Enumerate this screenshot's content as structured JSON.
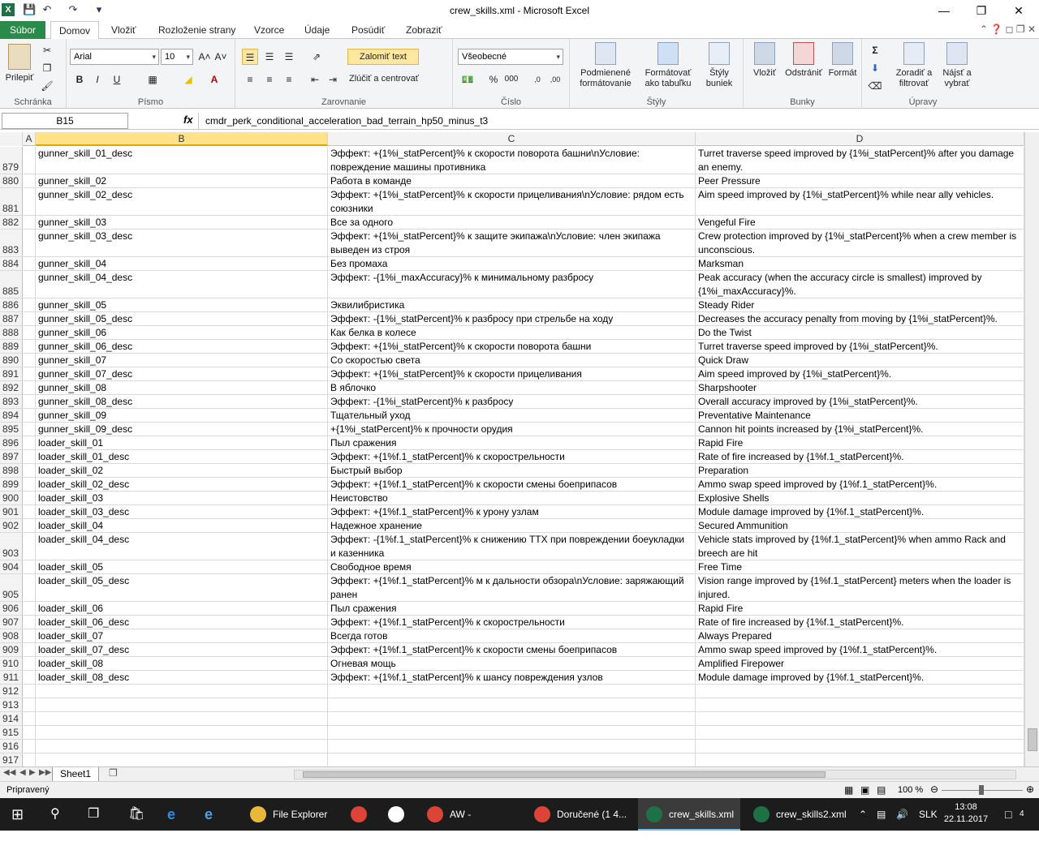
{
  "window": {
    "title": "crew_skills.xml  -  Microsoft Excel",
    "app_icon": "X",
    "qat": [
      "save-icon",
      "undo-icon",
      "redo-icon",
      "customize-icon"
    ],
    "controls": [
      "minimize-icon",
      "restore-icon",
      "close-icon"
    ]
  },
  "ribbon_tabs": {
    "file": "Súbor",
    "items": [
      "Domov",
      "Vložiť",
      "Rozloženie strany",
      "Vzorce",
      "Údaje",
      "Posúdiť",
      "Zobraziť"
    ],
    "active": "Domov"
  },
  "ribbon": {
    "clipboard": {
      "label": "Schránka",
      "paste": "Prilepiť"
    },
    "font": {
      "label": "Písmo",
      "name": "Arial",
      "size": "10",
      "bold": "B",
      "italic": "I",
      "underline": "U"
    },
    "alignment": {
      "label": "Zarovnanie",
      "wrap": "Zalomiť text",
      "merge": "Zlúčiť a centrovať"
    },
    "number": {
      "label": "Číslo",
      "format": "Všeobecné"
    },
    "styles": {
      "label": "Štýly",
      "conditional": [
        "Podmienené",
        "formátovanie"
      ],
      "table": [
        "Formátovať",
        "ako tabuľku"
      ],
      "cell": [
        "Štýly",
        "buniek"
      ]
    },
    "cells": {
      "label": "Bunky",
      "insert": "Vložiť",
      "delete": "Odstrániť",
      "format": "Formát"
    },
    "editing": {
      "label": "Úpravy",
      "sort": [
        "Zoradiť a",
        "filtrovať"
      ],
      "find": [
        "Nájsť a",
        "vybrať"
      ]
    }
  },
  "formula_bar": {
    "name_box": "B15",
    "fx": "fx",
    "formula": "cmdr_perk_conditional_acceleration_bad_terrain_hp50_minus_t3"
  },
  "columns": [
    "A",
    "B",
    "C",
    "D"
  ],
  "selected_column": "B",
  "rows": [
    {
      "n": "879",
      "b": "gunner_skill_01_desc",
      "c": "Эффект: +{1%i_statPercent}% к скорости поворота башни\\nУсловие: повреждение машины противника",
      "d": "Turret traverse speed improved by {1%i_statPercent}% after you damage an enemy.",
      "tall": true
    },
    {
      "n": "880",
      "b": "gunner_skill_02",
      "c": "Работа в команде",
      "d": "Peer Pressure"
    },
    {
      "n": "881",
      "b": "gunner_skill_02_desc",
      "c": "Эффект: +{1%i_statPercent}% к скорости прицеливания\\nУсловие: рядом есть союзники",
      "d": "Aim speed improved by {1%i_statPercent}% while near ally vehicles.",
      "tall": true
    },
    {
      "n": "882",
      "b": "gunner_skill_03",
      "c": "Все за одного",
      "d": "Vengeful Fire"
    },
    {
      "n": "883",
      "b": "gunner_skill_03_desc",
      "c": "Эффект: +{1%i_statPercent}% к защите экипажа\\nУсловие: член экипажа выведен из строя",
      "d": "Crew protection improved by {1%i_statPercent}% when a crew member is unconscious.",
      "tall": true
    },
    {
      "n": "884",
      "b": "gunner_skill_04",
      "c": "Без промаха",
      "d": "Marksman"
    },
    {
      "n": "885",
      "b": "gunner_skill_04_desc",
      "c": "Эффект: -{1%i_maxAccuracy}% к минимальному разбросу",
      "d": "Peak accuracy (when the accuracy circle is smallest) improved by {1%i_maxAccuracy}%.",
      "tall": true
    },
    {
      "n": "886",
      "b": "gunner_skill_05",
      "c": "Эквилибристика",
      "d": "Steady Rider"
    },
    {
      "n": "887",
      "b": "gunner_skill_05_desc",
      "c": "Эффект: -{1%i_statPercent}% к разбросу при стрельбе на ходу",
      "d": "Decreases the accuracy penalty from moving by {1%i_statPercent}%."
    },
    {
      "n": "888",
      "b": "gunner_skill_06",
      "c": "Как белка в колесе",
      "d": "Do the Twist"
    },
    {
      "n": "889",
      "b": "gunner_skill_06_desc",
      "c": "Эффект: +{1%i_statPercent}% к скорости поворота башни",
      "d": "Turret traverse speed improved by {1%i_statPercent}%."
    },
    {
      "n": "890",
      "b": "gunner_skill_07",
      "c": "Со скоростью света",
      "d": "Quick Draw"
    },
    {
      "n": "891",
      "b": "gunner_skill_07_desc",
      "c": "Эффект: +{1%i_statPercent}% к скорости прицеливания",
      "d": "Aim speed improved by {1%i_statPercent}%."
    },
    {
      "n": "892",
      "b": "gunner_skill_08",
      "c": "В яблочко",
      "d": "Sharpshooter"
    },
    {
      "n": "893",
      "b": "gunner_skill_08_desc",
      "c": "Эффект: -{1%i_statPercent}% к разбросу",
      "d": "Overall accuracy improved by {1%i_statPercent}%."
    },
    {
      "n": "894",
      "b": "gunner_skill_09",
      "c": "Тщательный уход",
      "d": "Preventative Maintenance"
    },
    {
      "n": "895",
      "b": "gunner_skill_09_desc",
      "c": "+{1%i_statPercent}% к прочности орудия",
      "d": "Cannon hit points increased by {1%i_statPercent}%."
    },
    {
      "n": "896",
      "b": "loader_skill_01",
      "c": "Пыл сражения",
      "d": "Rapid Fire"
    },
    {
      "n": "897",
      "b": "loader_skill_01_desc",
      "c": "Эффект: +{1%f.1_statPercent}% к скорострельности",
      "d": "Rate of fire increased by {1%f.1_statPercent}%."
    },
    {
      "n": "898",
      "b": "loader_skill_02",
      "c": "Быстрый выбор",
      "d": "Preparation"
    },
    {
      "n": "899",
      "b": "loader_skill_02_desc",
      "c": "Эффект: +{1%f.1_statPercent}% к скорости смены боеприпасов",
      "d": "Ammo swap speed improved by {1%f.1_statPercent}%."
    },
    {
      "n": "900",
      "b": "loader_skill_03",
      "c": "Неистовство",
      "d": "Explosive Shells"
    },
    {
      "n": "901",
      "b": "loader_skill_03_desc",
      "c": "Эффект: +{1%f.1_statPercent}% к урону узлам",
      "d": "Module damage improved by {1%f.1_statPercent}%."
    },
    {
      "n": "902",
      "b": "loader_skill_04",
      "c": "Надежное хранение",
      "d": "Secured Ammunition"
    },
    {
      "n": "903",
      "b": "loader_skill_04_desc",
      "c": "Эффект: -{1%f.1_statPercent}% к снижению ТТХ при повреждении боеукладки и казенника",
      "d": "Vehicle stats improved by {1%f.1_statPercent}% when ammo Rack and breech are hit",
      "tall": true
    },
    {
      "n": "904",
      "b": "loader_skill_05",
      "c": "Свободное время",
      "d": "Free Time"
    },
    {
      "n": "905",
      "b": "loader_skill_05_desc",
      "c": "Эффект: +{1%f.1_statPercent}% м к дальности обзора\\nУсловие: заряжающий ранен",
      "d": "Vision range improved by {1%f.1_statPercent} meters when the loader is injured.",
      "tall": true
    },
    {
      "n": "906",
      "b": "loader_skill_06",
      "c": "Пыл сражения",
      "d": "Rapid Fire"
    },
    {
      "n": "907",
      "b": "loader_skill_06_desc",
      "c": "Эффект: +{1%f.1_statPercent}% к скорострельности",
      "d": "Rate of fire increased by {1%f.1_statPercent}%."
    },
    {
      "n": "908",
      "b": "loader_skill_07",
      "c": "Всегда готов",
      "d": "Always Prepared"
    },
    {
      "n": "909",
      "b": "loader_skill_07_desc",
      "c": "Эффект: +{1%f.1_statPercent}% к скорости смены боеприпасов",
      "d": "Ammo swap speed improved by {1%f.1_statPercent}%."
    },
    {
      "n": "910",
      "b": "loader_skill_08",
      "c": "Огневая мощь",
      "d": "Amplified Firepower"
    },
    {
      "n": "911",
      "b": "loader_skill_08_desc",
      "c": "Эффект: +{1%f.1_statPercent}% к шансу повреждения узлов",
      "d": "Module damage improved by {1%f.1_statPercent}%."
    },
    {
      "n": "912",
      "b": "",
      "c": "",
      "d": ""
    },
    {
      "n": "913",
      "b": "",
      "c": "",
      "d": ""
    },
    {
      "n": "914",
      "b": "",
      "c": "",
      "d": ""
    },
    {
      "n": "915",
      "b": "",
      "c": "",
      "d": ""
    },
    {
      "n": "916",
      "b": "",
      "c": "",
      "d": ""
    },
    {
      "n": "917",
      "b": "",
      "c": "",
      "d": ""
    }
  ],
  "sheet_tabs": [
    "Sheet1"
  ],
  "status": {
    "ready": "Pripravený",
    "zoom": "100 %"
  },
  "taskbar": {
    "apps": [
      {
        "label": "File Explorer",
        "icon": "folder-icon",
        "color": "#e8b83a"
      },
      {
        "label": "",
        "icon": "chrome-icon",
        "color": "#db4437"
      },
      {
        "label": "",
        "icon": "mail-icon",
        "color": "#ffffff"
      },
      {
        "label": "AW - Slovenči...",
        "icon": "chrome-icon",
        "color": "#db4437"
      },
      {
        "label": "Doručené (1 4...",
        "icon": "chrome-icon",
        "color": "#db4437"
      },
      {
        "label": "crew_skills.xml",
        "icon": "excel-icon",
        "color": "#1e7145",
        "active": true
      },
      {
        "label": "crew_skills2.xml",
        "icon": "excel-icon",
        "color": "#1e7145"
      }
    ],
    "lang": "SLK",
    "time": "13:08",
    "date": "22.11.2017",
    "notifications": "4"
  }
}
